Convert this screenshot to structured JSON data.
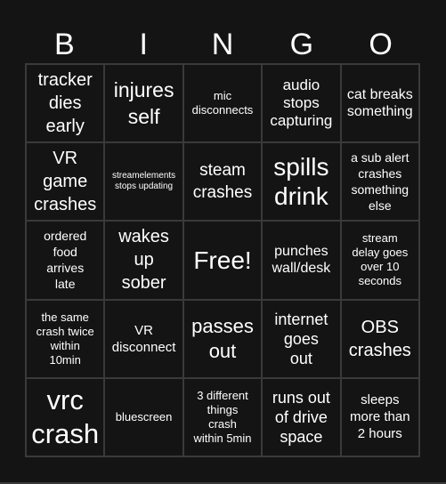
{
  "header": {
    "letters": [
      "B",
      "I",
      "N",
      "G",
      "O"
    ]
  },
  "board": {
    "cells": [
      "tracker\ndies\nearly",
      "injures\nself",
      "mic\ndisconnects",
      "audio\nstops\ncapturing",
      "cat breaks\nsomething",
      "VR\ngame\ncrashes",
      "streamelements\nstops updating",
      "steam\ncrashes",
      "spills\ndrink",
      "a sub alert\ncrashes\nsomething\nelse",
      "ordered\nfood\narrives\nlate",
      "wakes\nup\nsober",
      "Free!",
      "punches\nwall/desk",
      "stream\ndelay goes\nover 10\nseconds",
      "the same\ncrash twice\nwithin\n10min",
      "VR\ndisconnect",
      "passes\nout",
      "internet\ngoes\nout",
      "OBS\ncrashes",
      "vrc\ncrash",
      "bluescreen",
      "3 different\nthings\ncrash\nwithin 5min",
      "runs out\nof drive\nspace",
      "sleeps\nmore than\n2 hours"
    ]
  },
  "colors": {
    "background": "#141414",
    "grid_lines": "#3a3a3a",
    "text": "#ffffff"
  }
}
